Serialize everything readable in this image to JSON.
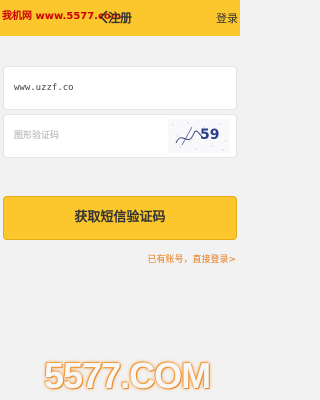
{
  "watermark_top": "我机网 www.5577.com",
  "header": {
    "title": "注册",
    "login_label": "登录"
  },
  "form": {
    "account": {
      "value": "www.uzzf.co",
      "placeholder": ""
    },
    "captcha": {
      "value": "",
      "placeholder": "图形验证码",
      "image_text": "59"
    },
    "submit_label": "获取短信验证码",
    "has_account_text": "已有账号，直接登录>"
  },
  "watermark_bottom": "5577.COM",
  "colors": {
    "accent": "#fbc72c",
    "link": "#e67e22"
  }
}
